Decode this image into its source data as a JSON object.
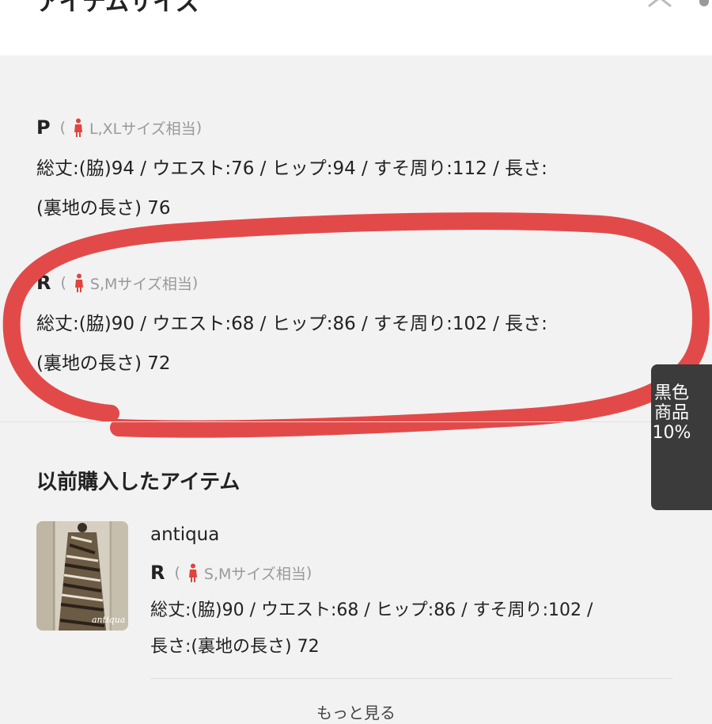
{
  "header": {
    "title": "アイテムサイズ"
  },
  "sizes": [
    {
      "code": "P",
      "fit": "L,XLサイズ相当",
      "detail": "総丈:(脇)94 / ウエスト:76 / ヒップ:94 / すそ周り:112 / 長さ:\n(裏地の長さ) 76"
    },
    {
      "code": "R",
      "fit": "S,Mサイズ相当",
      "detail": "総丈:(脇)90 / ウエスト:68 / ヒップ:86 / すそ周り:102 / 長さ:\n(裏地の長さ) 72"
    }
  ],
  "previous": {
    "title": "以前購入したアイテム",
    "item": {
      "brand": "antiqua",
      "code": "R",
      "fit": "S,Mサイズ相当",
      "detail": "総丈:(脇)90 / ウエスト:68 / ヒップ:86 / すそ周り:102 /\n長さ:(裏地の長さ) 72",
      "thumb_label": "antiqua"
    },
    "more_label": "もっと見る"
  },
  "side_tab": {
    "label": "黒色商品10%"
  },
  "colors": {
    "accent_person": "#e0443c",
    "annotation": "#e24a4a",
    "side_tab_bg": "#3b3b3b"
  },
  "icons": {
    "close": "close-icon",
    "person": "person-icon"
  }
}
